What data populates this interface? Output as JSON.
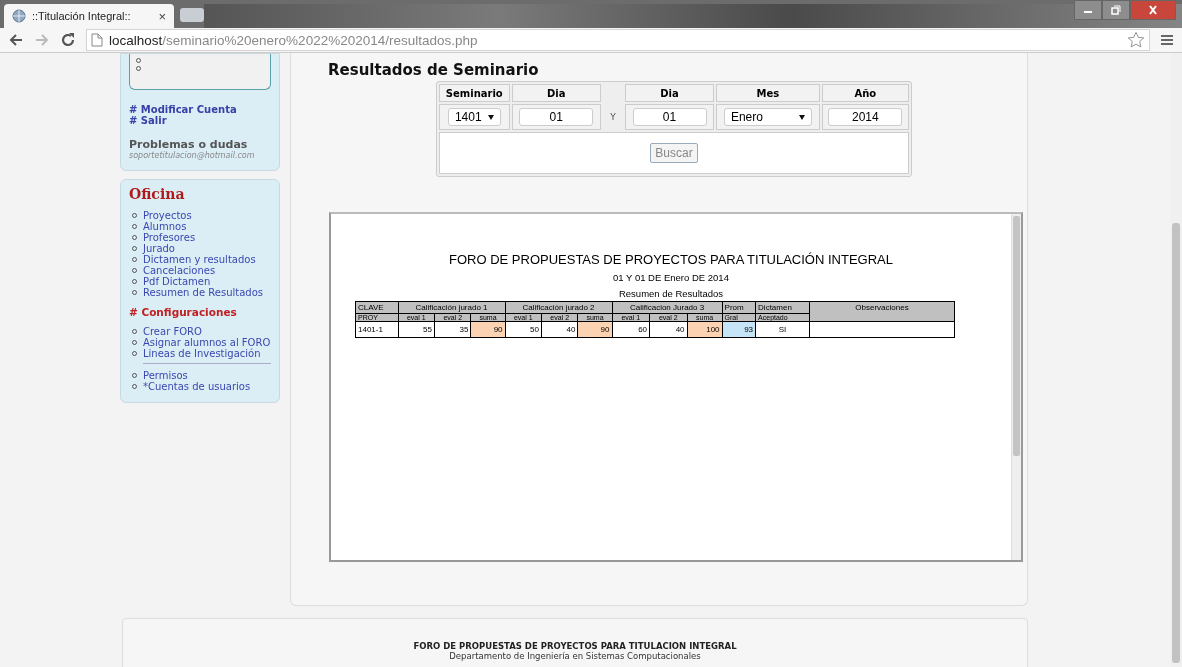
{
  "browser": {
    "tab_title": "::Titulación Integral::",
    "tab_close": "×",
    "url_host": "localhost",
    "url_path": "/seminario%20enero%2022%202014/resultados.php"
  },
  "sidebar": {
    "account_links": [
      "# Modificar Cuenta",
      "# Salir"
    ],
    "help_title": "Problemas o dudas",
    "help_email": "soportetitulacion@hotmail.com",
    "office_title": "Oficina",
    "office_items": [
      "Proyectos",
      "Alumnos",
      "Profesores",
      "Jurado",
      "Dictamen y resultados",
      "Cancelaciones",
      "Pdf Dictamen",
      "Resumen de Resultados"
    ],
    "config_title": "# Configuraciones",
    "config_groups": [
      [
        "Crear FORO",
        "Asignar alumnos al FORO",
        "Lineas de Investigación"
      ],
      [
        "Permisos",
        "*Cuentas de usuarios"
      ]
    ]
  },
  "main": {
    "title": "Resultados de Seminario",
    "form": {
      "headers": [
        "Seminario",
        "Dia",
        "Dia",
        "Mes",
        "Año"
      ],
      "fields": [
        {
          "kind": "select",
          "value": "1401"
        },
        {
          "kind": "input",
          "value": "01"
        },
        {
          "kind": "input",
          "value": "01"
        },
        {
          "kind": "select",
          "value": "Enero"
        },
        {
          "kind": "input",
          "value": "2014"
        }
      ],
      "separator": "Y",
      "button": "Buscar"
    },
    "report": {
      "title": "FORO DE PROPUESTAS DE PROYECTOS PARA TITULACIÓN INTEGRAL",
      "subtitle": "01 Y 01 DE Enero DE 2014",
      "caption": "Resumen de Resultados",
      "header_top": [
        {
          "label": "CLAVE",
          "kind": "single"
        },
        {
          "label": "Calificación jurado 1",
          "kind": "group"
        },
        {
          "label": "Calificación jurado 2",
          "kind": "group"
        },
        {
          "label": "Calificacion Jurado 3",
          "kind": "group"
        },
        {
          "label": "Prom",
          "kind": "single"
        },
        {
          "label": "Dictamen",
          "kind": "single"
        },
        {
          "label": "Observaciones",
          "kind": "tall"
        }
      ],
      "header_sub": [
        {
          "label": "PROY",
          "kind": "label"
        },
        {
          "label": "eval 1",
          "kind": "eval"
        },
        {
          "label": "eval 2",
          "kind": "eval"
        },
        {
          "label": "suma",
          "kind": "eval"
        },
        {
          "label": "eval 1",
          "kind": "eval"
        },
        {
          "label": "eval 2",
          "kind": "eval"
        },
        {
          "label": "suma",
          "kind": "eval"
        },
        {
          "label": "eval 1",
          "kind": "eval"
        },
        {
          "label": "eval 2",
          "kind": "eval"
        },
        {
          "label": "suma",
          "kind": "eval"
        },
        {
          "label": "Gral",
          "kind": "label"
        },
        {
          "label": "Aceptado",
          "kind": "label"
        }
      ],
      "rows": [
        {
          "cells": [
            {
              "value": "1401-1",
              "kind": "key"
            },
            {
              "value": "55",
              "kind": "num"
            },
            {
              "value": "35",
              "kind": "num"
            },
            {
              "value": "90",
              "kind": "suma"
            },
            {
              "value": "50",
              "kind": "num"
            },
            {
              "value": "40",
              "kind": "num"
            },
            {
              "value": "90",
              "kind": "suma"
            },
            {
              "value": "60",
              "kind": "num"
            },
            {
              "value": "40",
              "kind": "num"
            },
            {
              "value": "100",
              "kind": "suma"
            },
            {
              "value": "93",
              "kind": "prom"
            },
            {
              "value": "SI",
              "kind": "center"
            },
            {
              "kind": "empty"
            }
          ]
        }
      ]
    }
  },
  "footer": {
    "title": "FORO DE PROPUESTAS DE PROYECTOS PARA TITULACION INTEGRAL",
    "department": "Departamento de Ingeniería en Sistemas Computacionales"
  }
}
